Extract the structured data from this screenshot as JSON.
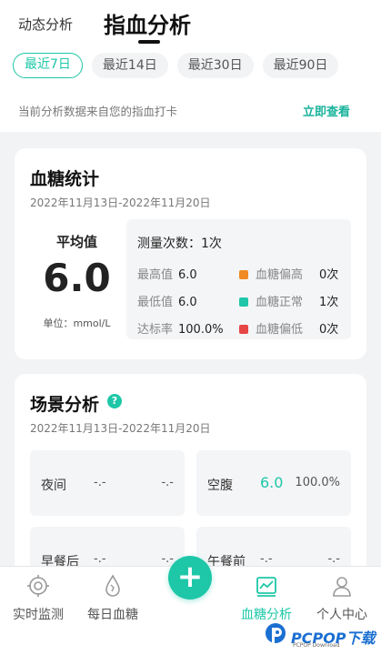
{
  "header": {
    "tab_dynamic": "动态分析",
    "tab_finger": "指血分析"
  },
  "ranges": [
    {
      "label": "最近7日",
      "active": true
    },
    {
      "label": "最近14日",
      "active": false
    },
    {
      "label": "最近30日",
      "active": false
    },
    {
      "label": "最近90日",
      "active": false
    }
  ],
  "source": {
    "text": "当前分析数据来自您的指血打卡",
    "link": "立即查看"
  },
  "stats_card": {
    "title": "血糖统计",
    "date_range": "2022年11月13日-2022年11月20日",
    "avg_label": "平均值",
    "avg_value": "6.0",
    "unit_label": "单位：mmol/L",
    "count_label": "测量次数：",
    "count_value": "1次",
    "max_label": "最高值",
    "max_value": "6.0",
    "min_label": "最低值",
    "min_value": "6.0",
    "rate_label": "达标率",
    "rate_value": "100.0%",
    "legend": [
      {
        "label": "血糖偏高",
        "value": "0次",
        "color": "#f08a24"
      },
      {
        "label": "血糖正常",
        "value": "1次",
        "color": "#1ec7a8"
      },
      {
        "label": "血糖偏低",
        "value": "0次",
        "color": "#e84545"
      }
    ]
  },
  "scene_card": {
    "title": "场景分析",
    "help_icon": "?",
    "date_range": "2022年11月13日-2022年11月20日",
    "scenes": [
      {
        "name": "夜间",
        "value": "-.-",
        "rate": "-.-"
      },
      {
        "name": "空腹",
        "value": "6.0",
        "rate": "100.0%"
      },
      {
        "name": "早餐后",
        "value": "-.-",
        "rate": "-.-"
      },
      {
        "name": "午餐前",
        "value": "-.-",
        "rate": "-.-"
      }
    ]
  },
  "bottom_nav": {
    "items": [
      {
        "label": "实时监测",
        "icon": "target-icon"
      },
      {
        "label": "每日血糖",
        "icon": "drop-icon"
      },
      {
        "label": "血糖分析",
        "icon": "chart-icon",
        "active": true
      },
      {
        "label": "个人中心",
        "icon": "person-icon"
      }
    ],
    "plus": "+"
  },
  "brand": {
    "text": "PCPOP下载",
    "sub": "PCPOP Download"
  },
  "colors": {
    "accent": "#1ec7a8"
  }
}
